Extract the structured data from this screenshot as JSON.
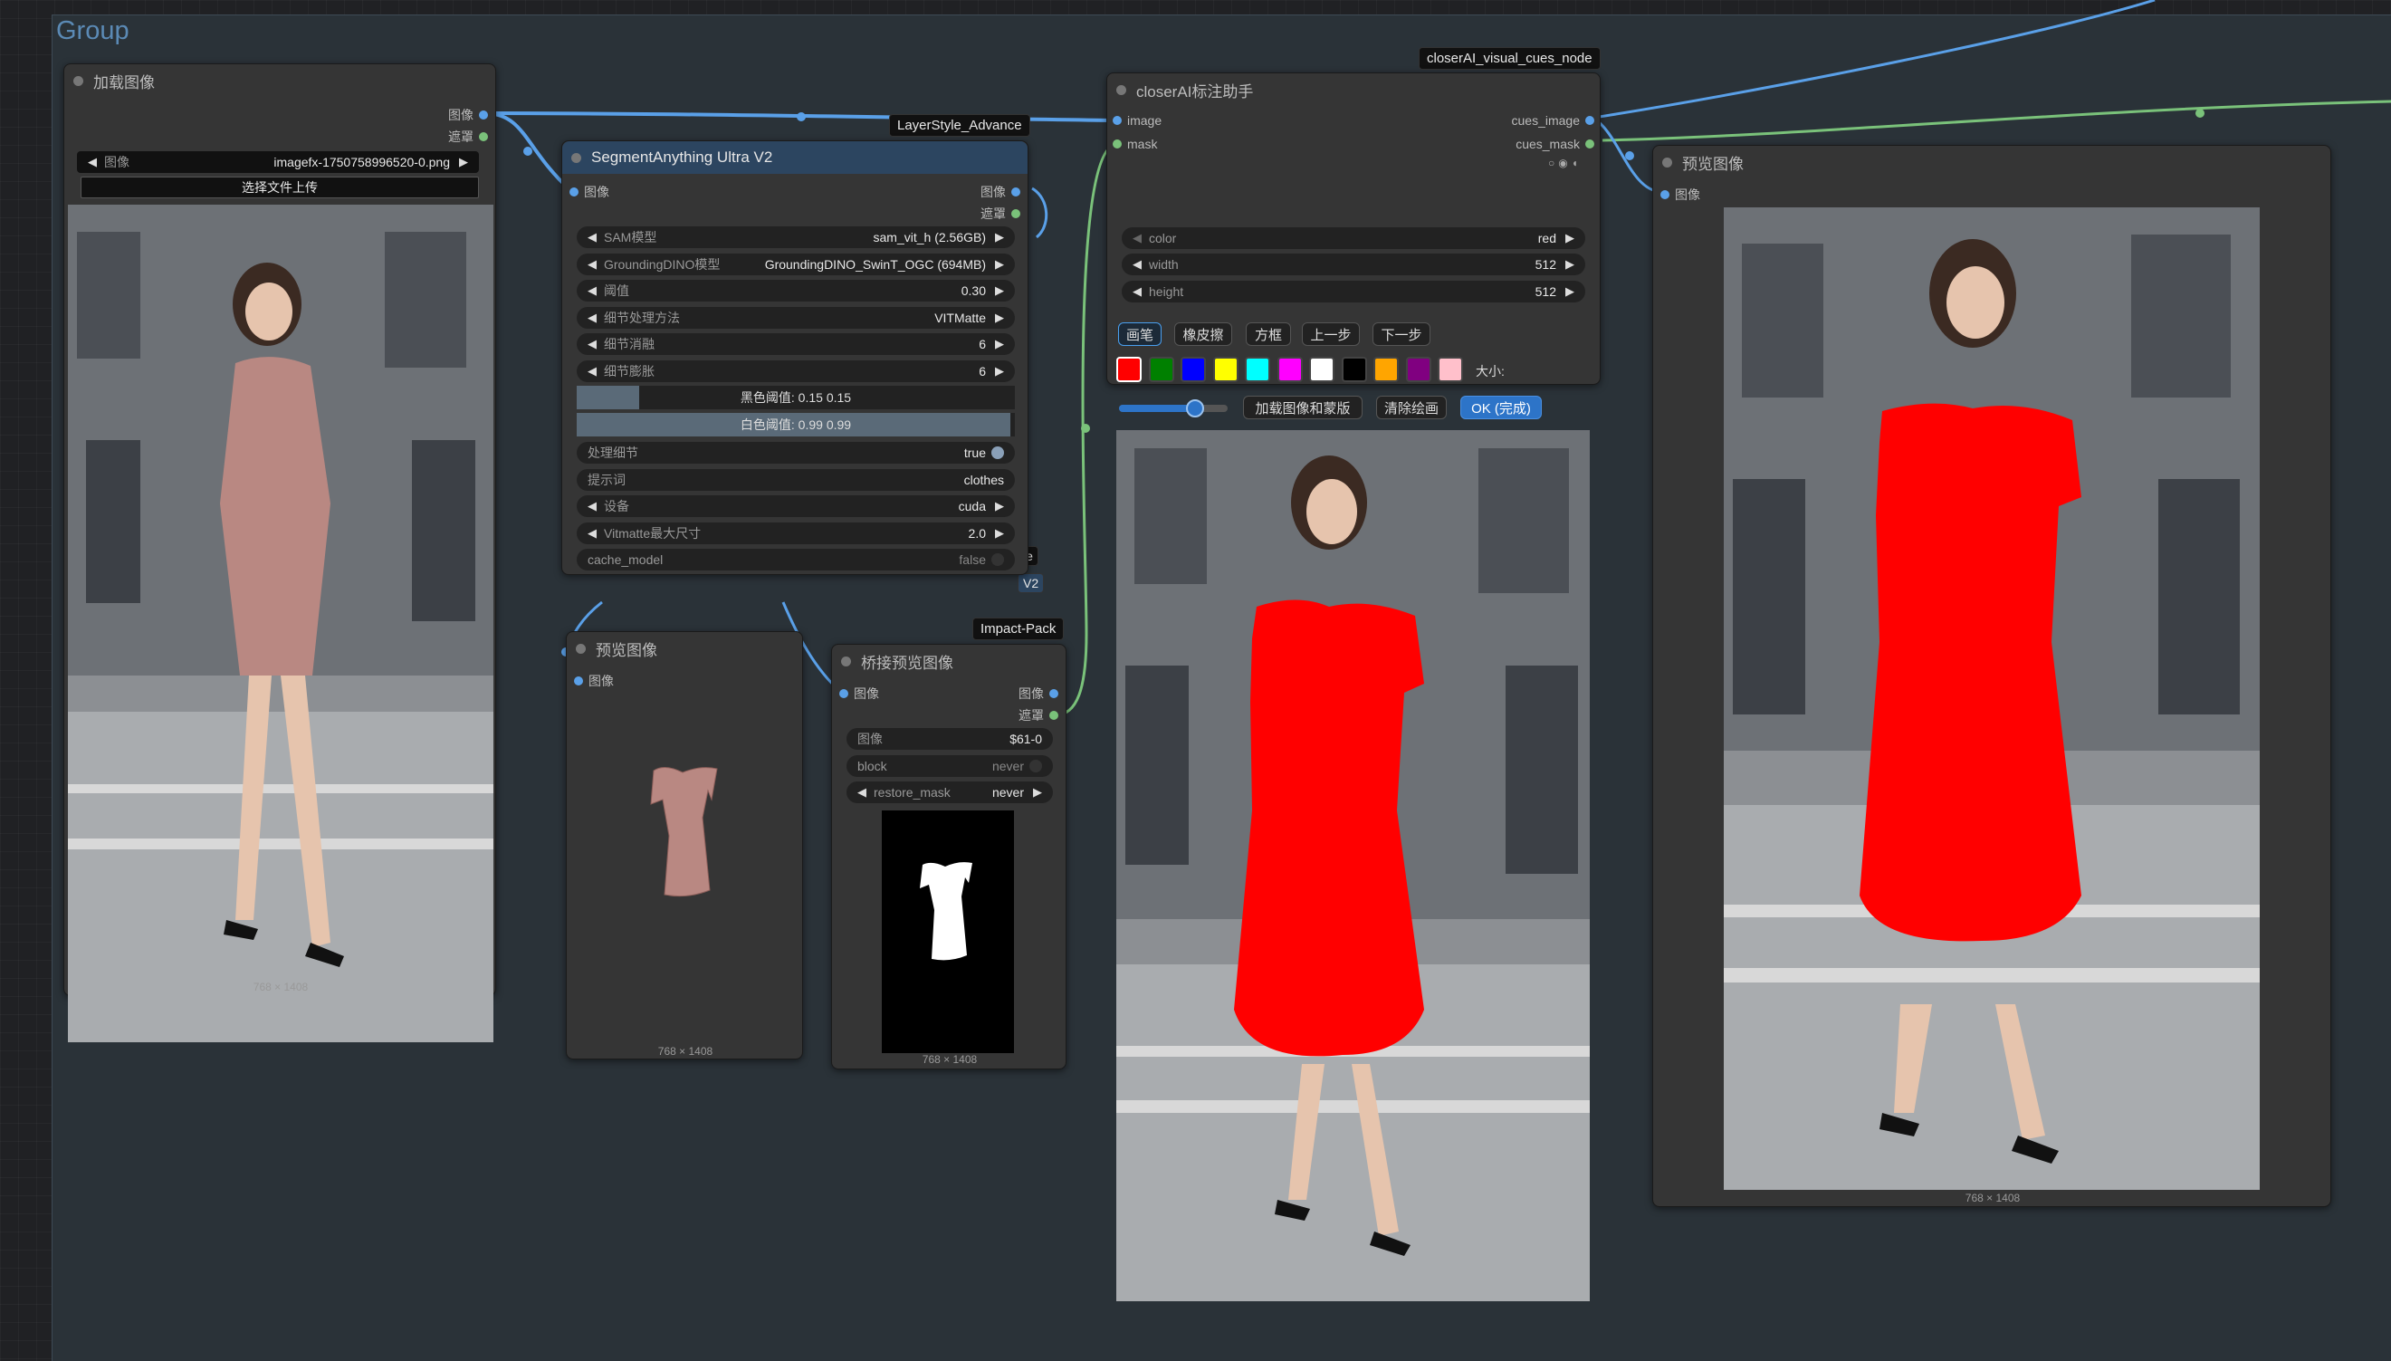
{
  "group": {
    "title": "Group"
  },
  "tags": {
    "layerstyle": "LayerStyle_Advance",
    "closerai": "closerAI_visual_cues_node",
    "impact": "Impact-Pack",
    "partial1": "le",
    "partial2": "V2"
  },
  "load_image": {
    "title": "加载图像",
    "out_image": "图像",
    "out_mask": "遮罩",
    "file_label": "图像",
    "file_value": "imagefx-1750758996520-0.png",
    "upload_label": "选择文件上传",
    "size": "768 × 1408"
  },
  "segment": {
    "title": "SegmentAnything Ultra V2",
    "in_image": "图像",
    "out_image": "图像",
    "out_mask": "遮罩",
    "widgets": [
      {
        "label": "SAM模型",
        "value": "sam_vit_h (2.56GB)"
      },
      {
        "label": "GroundingDINO模型",
        "value": "GroundingDINO_SwinT_OGC (694MB)"
      },
      {
        "label": "阈值",
        "value": "0.30"
      },
      {
        "label": "细节处理方法",
        "value": "VITMatte"
      },
      {
        "label": "细节消融",
        "value": "6"
      },
      {
        "label": "细节膨胀",
        "value": "6"
      }
    ],
    "black_threshold": "黑色阈值: 0.15  0.15",
    "black_fraction": 0.15,
    "white_threshold": "白色阈值: 0.99  0.99",
    "white_fraction": 0.99,
    "process_detail_label": "处理细节",
    "process_detail_value": "true",
    "prompt_label": "提示词",
    "prompt_value": "clothes",
    "device_label": "设备",
    "device_value": "cuda",
    "vitmatte_label": "Vitmatte最大尺寸",
    "vitmatte_value": "2.0",
    "cache_label": "cache_model",
    "cache_value": "false"
  },
  "preview1": {
    "title": "预览图像",
    "in_image": "图像",
    "size": "768 × 1408"
  },
  "bridge": {
    "title": "桥接预览图像",
    "in_image": "图像",
    "out_image": "图像",
    "out_mask": "遮罩",
    "image_label": "图像",
    "image_value": "$61-0",
    "block_label": "block",
    "block_value": "never",
    "restore_label": "restore_mask",
    "restore_value": "never",
    "size": "768 × 1408"
  },
  "closer": {
    "title": "closerAI标注助手",
    "in_image": "image",
    "in_mask": "mask",
    "out_image": "cues_image",
    "out_mask": "cues_mask",
    "color_label": "color",
    "color_value": "red",
    "width_label": "width",
    "width_value": "512",
    "height_label": "height",
    "height_value": "512",
    "tools": [
      "画笔",
      "橡皮擦",
      "方框",
      "上一步",
      "下一步"
    ],
    "swatches": [
      "#ff0000",
      "#008000",
      "#0000ff",
      "#ffff00",
      "#00ffff",
      "#ff00ff",
      "#ffffff",
      "#000000",
      "#ffa500",
      "#800080",
      "#ffc0cb"
    ],
    "size_label": "大小:",
    "brush_size": 0.7,
    "load_btn": "加载图像和蒙版",
    "clear_btn": "清除绘画",
    "ok_btn": "OK (完成)"
  },
  "preview2": {
    "title": "预览图像",
    "in_image": "图像",
    "size": "768 × 1408"
  }
}
